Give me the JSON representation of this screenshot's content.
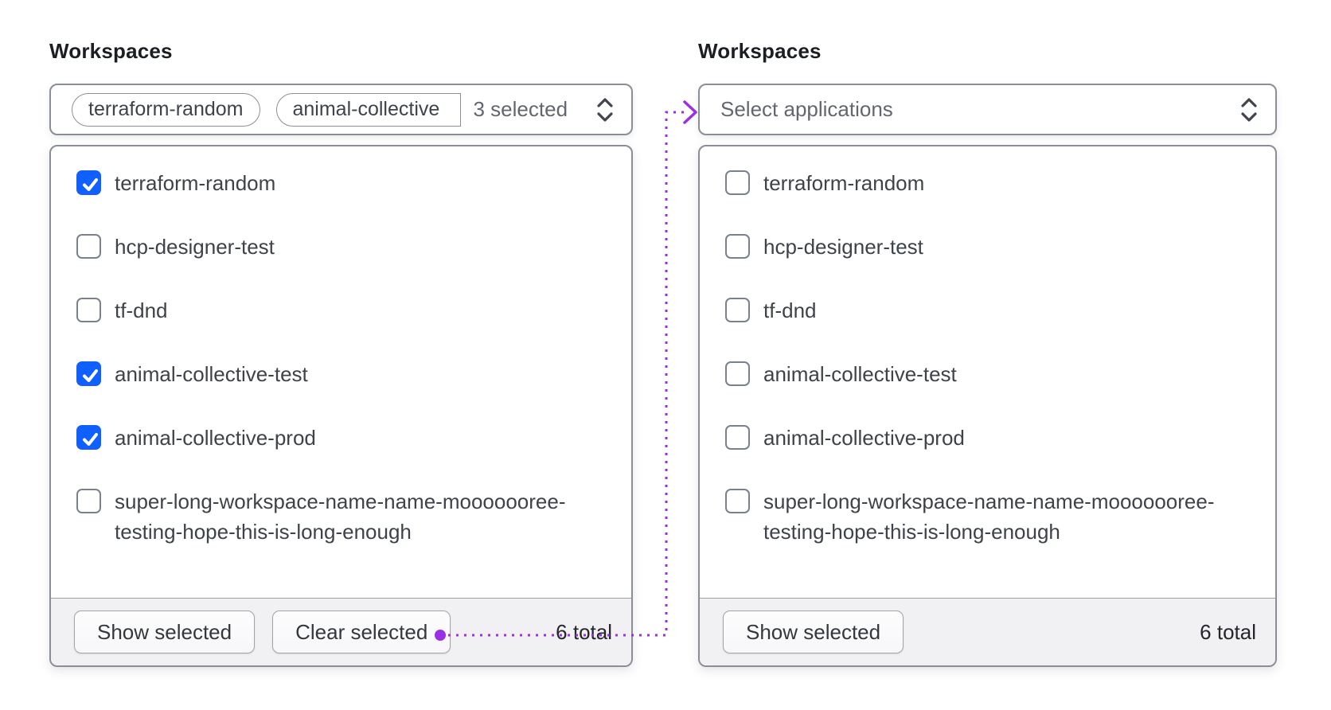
{
  "colors": {
    "accent_blue": "#1060ff",
    "annotation_purple": "#9b2fe3",
    "panel_border": "#898e97",
    "footer_background": "#f1f1f3"
  },
  "left_panel": {
    "label": "Workspaces",
    "trigger": {
      "tags": [
        "terraform-random",
        "animal-collective"
      ],
      "count_text": "3 selected"
    },
    "options": [
      {
        "label": "terraform-random",
        "checked": true
      },
      {
        "label": "hcp-designer-test",
        "checked": false
      },
      {
        "label": "tf-dnd",
        "checked": false
      },
      {
        "label": "animal-collective-test",
        "checked": true
      },
      {
        "label": "animal-collective-prod",
        "checked": true
      },
      {
        "label": "super-long-workspace-name-name-mooooooree-testing-hope-this-is-long-enough",
        "checked": false
      }
    ],
    "footer": {
      "show_selected_label": "Show selected",
      "clear_selected_label": "Clear selected",
      "total_text": "6 total"
    }
  },
  "right_panel": {
    "label": "Workspaces",
    "trigger": {
      "placeholder": "Select applications"
    },
    "options": [
      {
        "label": "terraform-random",
        "checked": false
      },
      {
        "label": "hcp-designer-test",
        "checked": false
      },
      {
        "label": "tf-dnd",
        "checked": false
      },
      {
        "label": "animal-collective-test",
        "checked": false
      },
      {
        "label": "animal-collective-prod",
        "checked": false
      },
      {
        "label": "super-long-workspace-name-name-mooooooree-testing-hope-this-is-long-enough",
        "checked": false
      }
    ],
    "footer": {
      "show_selected_label": "Show selected",
      "total_text": "6 total"
    }
  }
}
